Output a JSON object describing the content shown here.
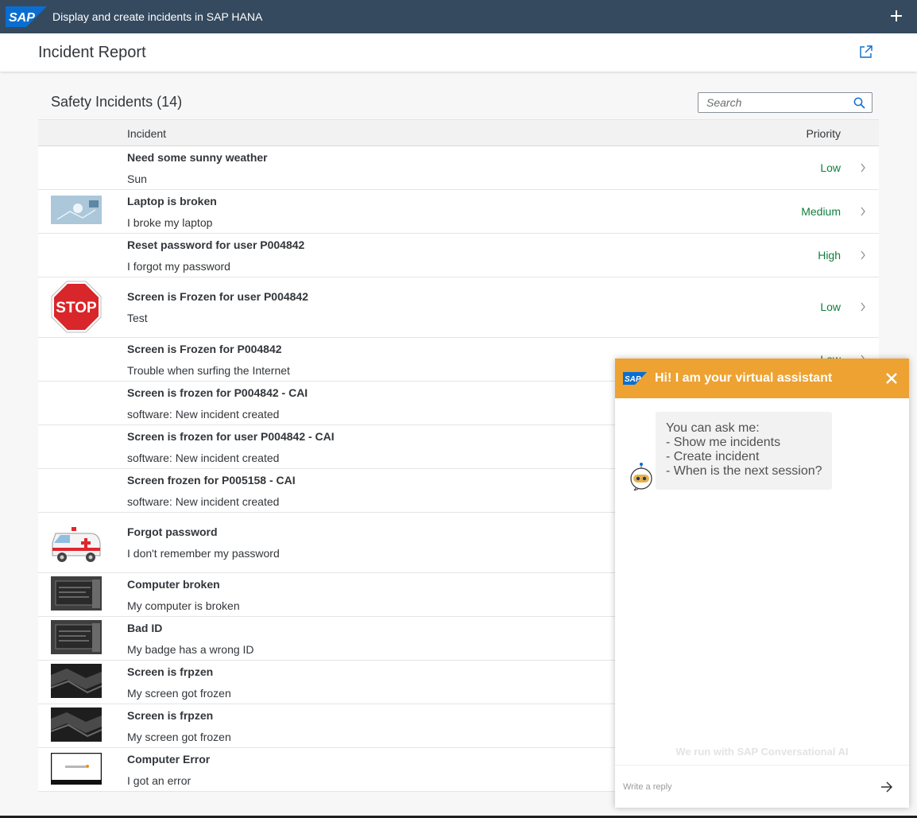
{
  "shell": {
    "logo_text": "SAP",
    "title": "Display and create incidents in SAP HANA"
  },
  "page": {
    "title": "Incident Report"
  },
  "table": {
    "title": "Safety Incidents (14)",
    "search_placeholder": "Search",
    "col_incident": "Incident",
    "col_priority": "Priority",
    "rows": [
      {
        "title": "Need some sunny weather",
        "desc": "Sun",
        "priority": "Low"
      },
      {
        "title": "Laptop is broken",
        "desc": "I broke my laptop",
        "priority": "Medium"
      },
      {
        "title": "Reset password for user P004842",
        "desc": "I forgot my password",
        "priority": "High"
      },
      {
        "title": "Screen is Frozen for user P004842",
        "desc": "Test",
        "priority": "Low"
      },
      {
        "title": "Screen is Frozen for P004842",
        "desc": "Trouble when surfing the Internet",
        "priority": "Low"
      },
      {
        "title": "Screen is frozen for P004842 - CAI",
        "desc": "software: New incident created",
        "priority": ""
      },
      {
        "title": "Screen is frozen for user P004842 - CAI",
        "desc": "software: New incident created",
        "priority": ""
      },
      {
        "title": "Screen frozen for P005158 - CAI",
        "desc": "software: New incident created",
        "priority": ""
      },
      {
        "title": "Forgot password",
        "desc": "I don't remember my password",
        "priority": ""
      },
      {
        "title": "Computer broken",
        "desc": "My computer is broken",
        "priority": ""
      },
      {
        "title": "Bad ID",
        "desc": "My badge has a wrong ID",
        "priority": ""
      },
      {
        "title": "Screen is frpzen",
        "desc": "My screen got frozen",
        "priority": ""
      },
      {
        "title": "Screen is frpzen",
        "desc": "My screen got frozen",
        "priority": ""
      },
      {
        "title": "Computer Error",
        "desc": "I got an error",
        "priority": ""
      }
    ]
  },
  "chat": {
    "logo_text": "SAP",
    "title": "Hi! I am your virtual assistant",
    "message_lines": [
      "You can ask me:",
      "- Show me incidents",
      "- Create incident",
      "- When is the next session?"
    ],
    "powered_by": "We run with SAP Conversational AI",
    "reply_placeholder": "Write a reply"
  },
  "stop_sign_text": "STOP",
  "colors": {
    "shell": "#354a5f",
    "priority_positive": "#107e3e",
    "chat_header": "#eda232"
  }
}
